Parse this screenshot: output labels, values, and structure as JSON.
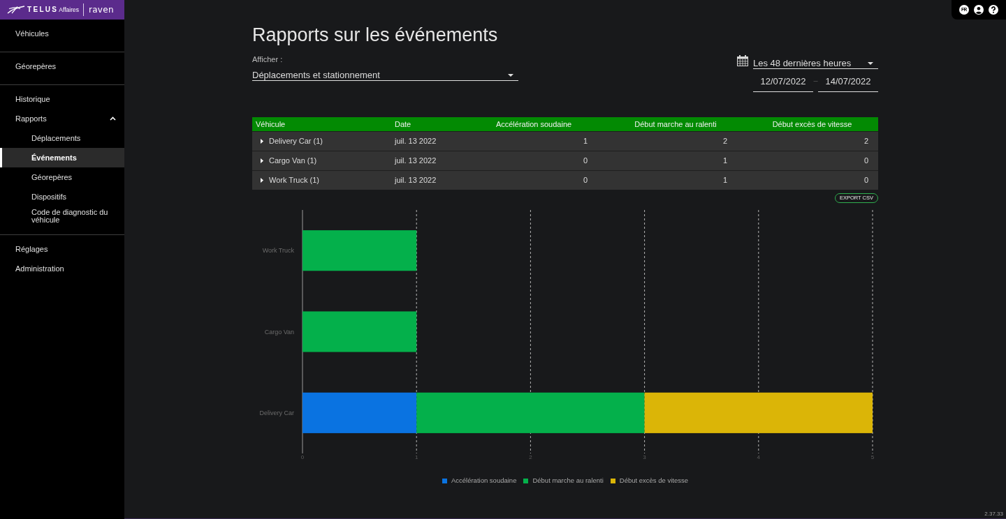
{
  "brand": {
    "name": "TELUS",
    "division": "Affaires",
    "product": "raven"
  },
  "sidebar": {
    "groups": [
      {
        "items": [
          {
            "label": "Véhicules",
            "selected": false
          }
        ]
      },
      {
        "items": [
          {
            "label": "Géorepères",
            "selected": false
          }
        ]
      },
      {
        "items": [
          {
            "label": "Historique",
            "selected": false
          },
          {
            "label": "Rapports",
            "selected": false,
            "expanded": true,
            "children": [
              {
                "label": "Déplacements",
                "selected": false
              },
              {
                "label": "Événements",
                "selected": true
              },
              {
                "label": "Géorepères",
                "selected": false
              },
              {
                "label": "Dispositifs",
                "selected": false
              },
              {
                "label": "Code de diagnostic du véhicule",
                "selected": false
              }
            ]
          }
        ]
      },
      {
        "items": [
          {
            "label": "Réglages",
            "selected": false
          },
          {
            "label": "Administration",
            "selected": false
          }
        ]
      }
    ]
  },
  "top_bar": {
    "language": "FR"
  },
  "page": {
    "title": "Rapports sur les événements"
  },
  "filters": {
    "show": {
      "label": "Afficher :",
      "value": "Déplacements et stationnement"
    },
    "period": {
      "value": "Les 48 dernières heures",
      "start": "12/07/2022",
      "separator": "–",
      "end": "14/07/2022"
    }
  },
  "table": {
    "columns": [
      "Véhicule",
      "Date",
      "Accélération soudaine",
      "Début marche au ralenti",
      "Début excès de vitesse"
    ],
    "rows": [
      {
        "expanded": false,
        "cells": [
          "Delivery Car (1)",
          "juil. 13 2022",
          "1",
          "2",
          "2"
        ]
      },
      {
        "expanded": false,
        "cells": [
          "Cargo Van (1)",
          "juil. 13 2022",
          "0",
          "1",
          "0"
        ]
      },
      {
        "expanded": false,
        "cells": [
          "Work Truck (1)",
          "juil. 13 2022",
          "0",
          "1",
          "0"
        ]
      }
    ]
  },
  "export_button": "EXPORT CSV",
  "chart": {
    "chart_data": {
      "type": "bar",
      "orientation": "horizontal",
      "stacked": true,
      "categories": [
        "Work Truck",
        "Cargo Van",
        "Delivery Car"
      ],
      "series": [
        {
          "name": "Accélération soudaine",
          "color": "#0a73e1",
          "values": [
            0,
            0,
            1
          ]
        },
        {
          "name": "Début marche au ralenti",
          "color": "#04b04b",
          "values": [
            1,
            1,
            2
          ]
        },
        {
          "name": "Début excès de vitesse",
          "color": "#dbb507",
          "values": [
            0,
            0,
            2
          ]
        }
      ],
      "xlim": [
        0,
        5
      ],
      "xticks": [
        {
          "value": 0,
          "label": "0"
        },
        {
          "value": 1,
          "label": "1"
        },
        {
          "value": 2,
          "label": "2"
        },
        {
          "value": 3,
          "label": "3"
        },
        {
          "value": 4,
          "label": "4"
        },
        {
          "value": 5,
          "label": "5"
        }
      ],
      "grid": true,
      "legend": true
    }
  },
  "version": "2.37.33"
}
